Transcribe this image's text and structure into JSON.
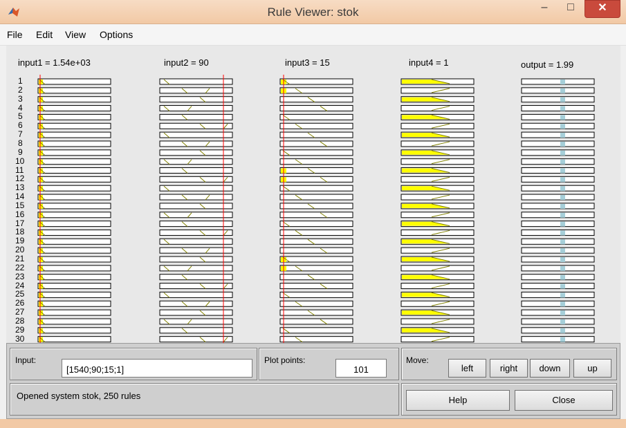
{
  "window": {
    "title": "Rule Viewer: stok"
  },
  "menu": [
    "File",
    "Edit",
    "View",
    "Options"
  ],
  "columns": [
    {
      "header": "input1 = 1.54e+03"
    },
    {
      "header": "input2 = 90"
    },
    {
      "header": "input3 = 15"
    },
    {
      "header": "input4 = 1"
    },
    {
      "header": "output = 1.99"
    }
  ],
  "rules": {
    "numbers": [
      "1",
      "2",
      "3",
      "4",
      "5",
      "6",
      "7",
      "8",
      "9",
      "10",
      "11",
      "12",
      "13",
      "14",
      "15",
      "16",
      "17",
      "18",
      "19",
      "20",
      "21",
      "22",
      "23",
      "24",
      "25",
      "26",
      "27",
      "28",
      "29",
      "30"
    ]
  },
  "controls": {
    "input_label": "Input:",
    "input_value": "[1540;90;15;1]",
    "plot_points_label": "Plot points:",
    "plot_points_value": "101",
    "move_label": "Move:",
    "left": "left",
    "right": "right",
    "down": "down",
    "up": "up",
    "help": "Help",
    "close": "Close"
  },
  "status": "Opened system stok, 250 rules",
  "colors": {
    "fill": "#ffff00",
    "line": "#808000",
    "marker": "#ff0000",
    "output_band": "#a6cfd9"
  }
}
